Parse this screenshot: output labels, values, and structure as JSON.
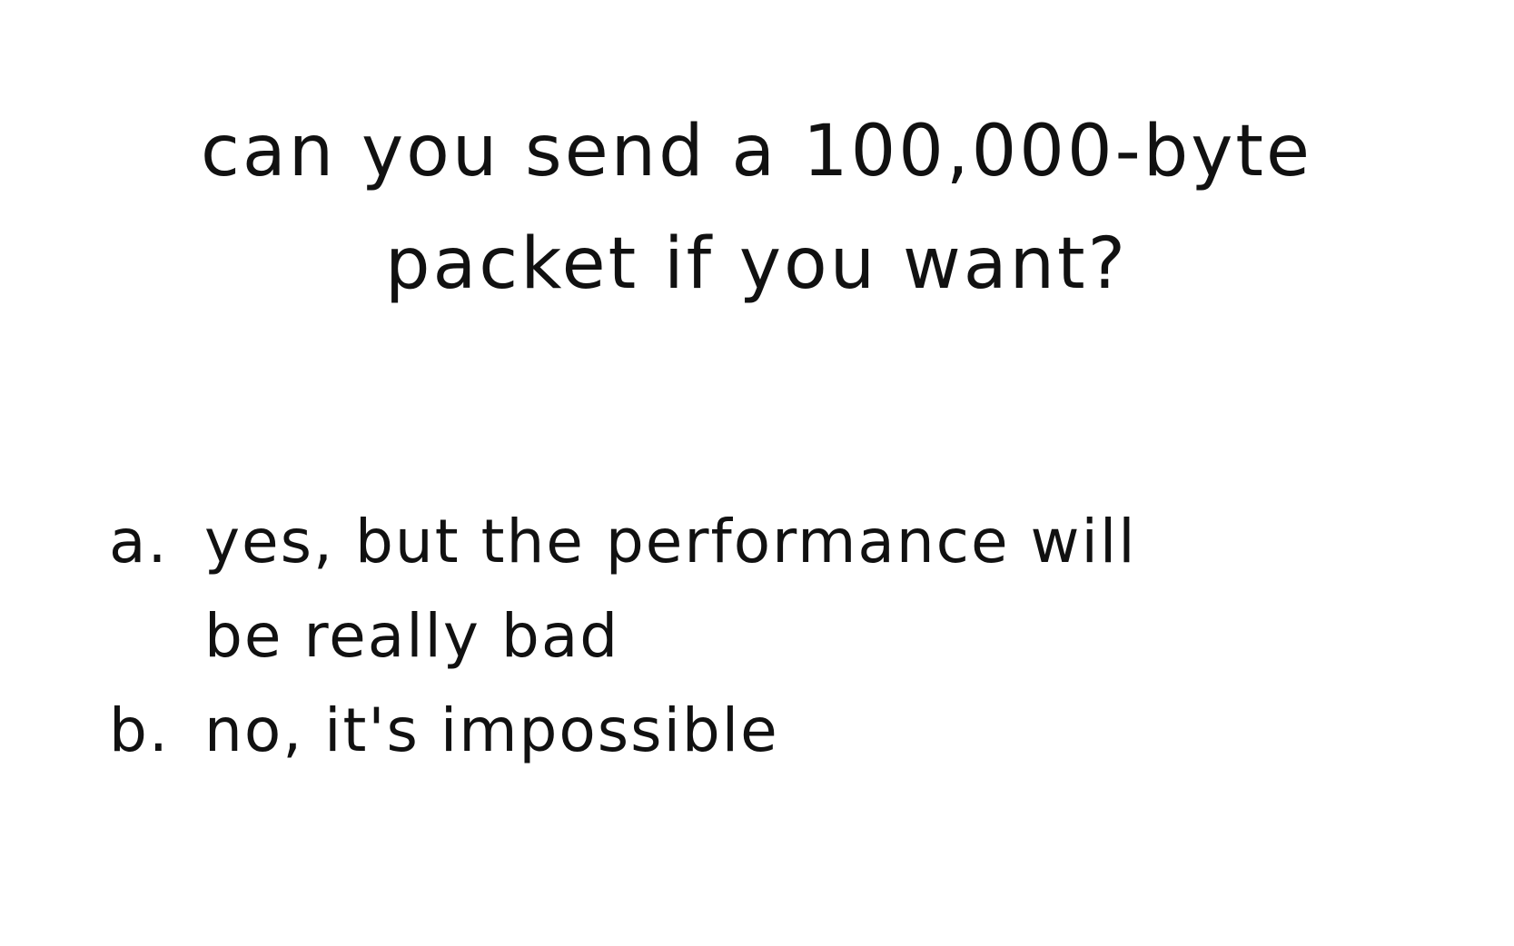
{
  "question": {
    "line1": "can you send a 100,000-byte",
    "line2": "packet if you want?"
  },
  "options": [
    {
      "marker": "a.",
      "line1": "yes, but the performance will",
      "line2": "be really bad"
    },
    {
      "marker": "b.",
      "line1": "no, it's impossible"
    }
  ]
}
